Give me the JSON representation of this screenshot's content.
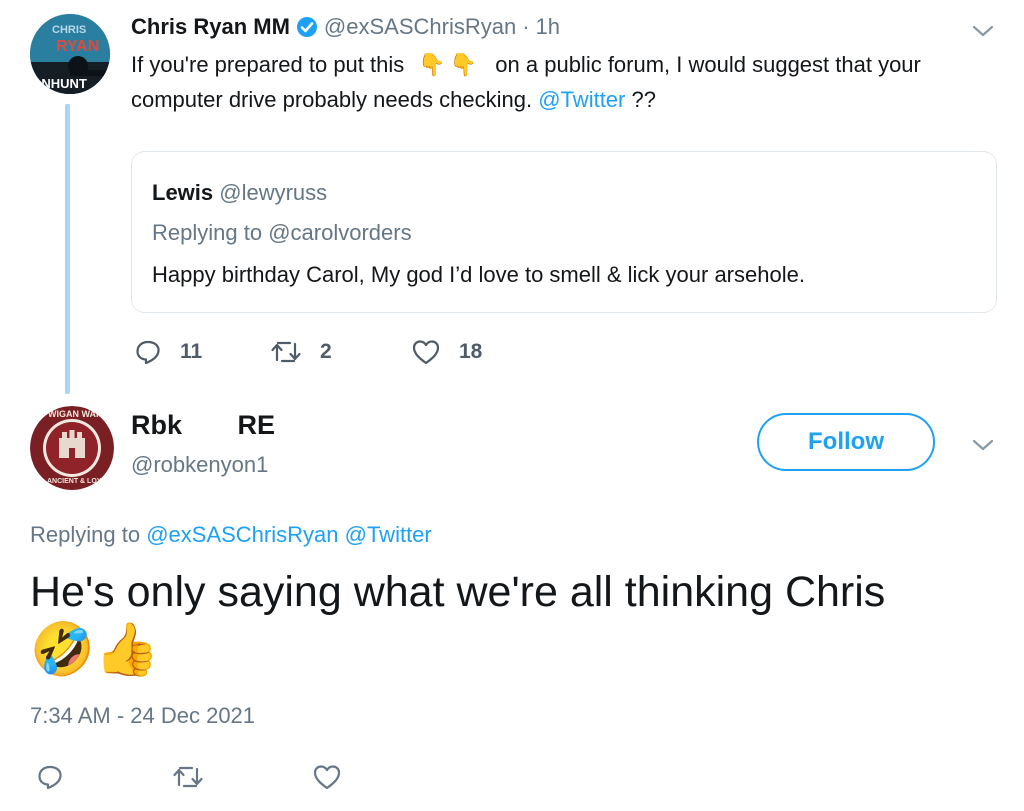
{
  "parent_tweet": {
    "avatar_text": {
      "top": "CHRIS",
      "middle": "RYAN",
      "bottom": "ANHUNT"
    },
    "author_name": "Chris Ryan MM",
    "handle": "@exSASChrisRyan",
    "separator": "·",
    "time": "1h",
    "text_part1": "If you're prepared to put this",
    "emoji_fingers": "👇👇",
    "text_part2": "on a public forum, I would suggest that your",
    "text_line2": "computer drive probably needs checking.",
    "mention": "@Twitter",
    "text_end": "??",
    "quoted": {
      "name": "Lewis",
      "handle": "@lewyruss",
      "replying_label": "Replying to",
      "replying_handle": "@carolvorders",
      "text": "Happy birthday Carol, My god I’d love to smell & lick your arsehole."
    },
    "stats": {
      "replies": "11",
      "retweets": "2",
      "likes": "18"
    }
  },
  "reply_tweet": {
    "avatar_text": {
      "ring": "WIGAN WARRIORS",
      "motto": "ANCIENT & LOYAL"
    },
    "name_first": "Rbk",
    "name_second": "RE",
    "handle": "@robkenyon1",
    "follow_label": "Follow",
    "replying_label": "Replying to",
    "replying_handle1": "@exSASChrisRyan",
    "replying_handle2": "@Twitter",
    "text": "He's only saying what we're all thinking Chris",
    "emojis": "🤣👍",
    "timestamp": "7:34 AM - 24 Dec 2021"
  },
  "colors": {
    "accent": "#1da1f2",
    "muted": "#657786",
    "verified": "#1da1f2",
    "border": "#e1e8ed"
  }
}
